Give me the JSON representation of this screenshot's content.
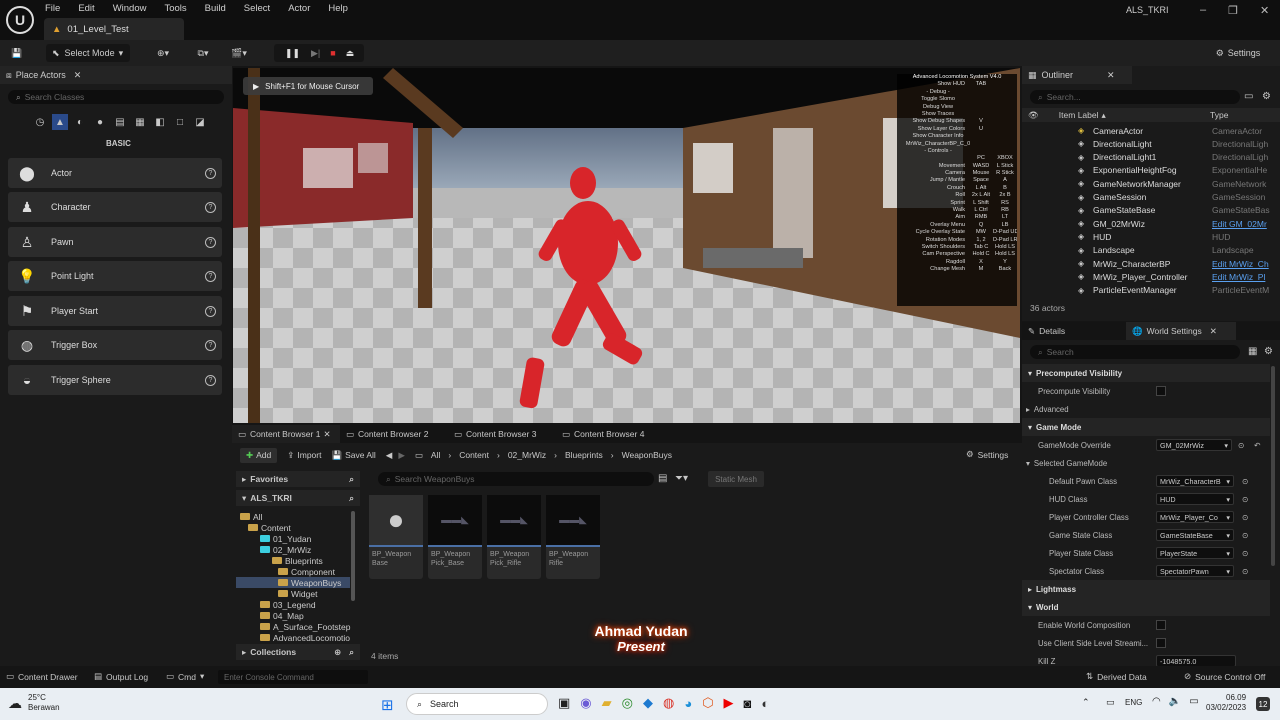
{
  "app": {
    "project": "ALS_TKRI",
    "level_tab": "01_Level_Test",
    "menus": [
      "File",
      "Edit",
      "Window",
      "Tools",
      "Build",
      "Select",
      "Actor",
      "Help"
    ]
  },
  "toolbar": {
    "select_mode": "Select Mode",
    "settings": "Settings"
  },
  "place_actors": {
    "title": "Place Actors",
    "search_placeholder": "Search Classes",
    "category": "BASIC",
    "items": [
      "Actor",
      "Character",
      "Pawn",
      "Point Light",
      "Player Start",
      "Trigger Box",
      "Trigger Sphere"
    ]
  },
  "viewport": {
    "hint": "Shift+F1 for Mouse Cursor",
    "hud_title": "Advanced Locomotion System V4.0",
    "hud_rows": [
      [
        "Show HUD",
        "TAB",
        ""
      ],
      [
        "- Debug -",
        "",
        ""
      ],
      [
        "Toggle Slomo",
        "",
        ""
      ],
      [
        "Debug View",
        "",
        ""
      ],
      [
        "Show Traces",
        "",
        ""
      ],
      [
        "Show Debug Shapes",
        "V",
        ""
      ],
      [
        "Show Layer Colors",
        "U",
        ""
      ],
      [
        "Show Character Info",
        "",
        ""
      ],
      [
        "MrWiz_CharacterBP_C_0",
        "",
        ""
      ],
      [
        "- Controls -",
        "",
        ""
      ],
      [
        "",
        "PC",
        "XBOX"
      ],
      [
        "Movement",
        "WASD",
        "L Stick"
      ],
      [
        "Camera",
        "Mouse",
        "R Stick"
      ],
      [
        "Jump / Mantle",
        "Space",
        "A"
      ],
      [
        "Crouch",
        "L Alt",
        "B"
      ],
      [
        "Roll",
        "2x L Alt",
        "2x B"
      ],
      [
        "Sprint",
        "L Shift",
        "RS"
      ],
      [
        "Walk",
        "L Ctrl",
        "RB"
      ],
      [
        "Aim",
        "RMB",
        "LT"
      ],
      [
        "Overlay Menu",
        "Q",
        "LB"
      ],
      [
        "Cycle Overlay State",
        "MW",
        "D-Pad UD"
      ],
      [
        "Rotation Modes",
        "1, 2",
        "D-Pad LR"
      ],
      [
        "Switch Shoulders",
        "Tab C",
        "Hold LS"
      ],
      [
        "Cam Perspective",
        "Hold C",
        "Hold LS"
      ],
      [
        "Ragdoll",
        "X",
        "Y"
      ],
      [
        "Change Mesh",
        "M",
        "Back"
      ]
    ]
  },
  "content_browser": {
    "tabs": [
      "Content Browser 1",
      "Content Browser 2",
      "Content Browser 3",
      "Content Browser 4"
    ],
    "add": "Add",
    "import": "Import",
    "save_all": "Save All",
    "settings": "Settings",
    "breadcrumb": [
      "All",
      "Content",
      "02_MrWiz",
      "Blueprints",
      "WeaponBuys"
    ],
    "favorites": "Favorites",
    "root": "ALS_TKRI",
    "search_placeholder": "Search WeaponBuys",
    "filter": "Static Mesh",
    "tree": [
      "All",
      "Content",
      "01_Yudan",
      "02_MrWiz",
      "Blueprints",
      "Component",
      "WeaponBuys",
      "Widget",
      "03_Legend",
      "04_Map",
      "A_Surface_Footstep",
      "AdvancedLocomotio"
    ],
    "assets": [
      [
        "BP_Weapon",
        "Base"
      ],
      [
        "BP_Weapon",
        "Pick_Base"
      ],
      [
        "BP_Weapon",
        "Pick_Rifle"
      ],
      [
        "BP_Weapon",
        "Rifle"
      ]
    ],
    "item_count": "4 items",
    "collections": "Collections"
  },
  "outliner": {
    "title": "Outliner",
    "search_placeholder": "Search...",
    "col_label": "Item Label",
    "col_type": "Type",
    "actor_count": "36 actors",
    "rows": [
      [
        "CameraActor",
        "CameraActor"
      ],
      [
        "DirectionalLight",
        "DirectionalLigh"
      ],
      [
        "DirectionalLight1",
        "DirectionalLigh"
      ],
      [
        "ExponentialHeightFog",
        "ExponentialHe"
      ],
      [
        "GameNetworkManager",
        "GameNetwork"
      ],
      [
        "GameSession",
        "GameSession"
      ],
      [
        "GameStateBase",
        "GameStateBas"
      ],
      [
        "GM_02MrWiz",
        "Edit GM_02Mr"
      ],
      [
        "HUD",
        "HUD"
      ],
      [
        "Landscape",
        "Landscape"
      ],
      [
        "MrWiz_CharacterBP",
        "Edit MrWiz_Ch"
      ],
      [
        "MrWiz_Player_Controller",
        "Edit MrWiz_Pl"
      ],
      [
        "ParticleEventManager",
        "ParticleEventM"
      ]
    ]
  },
  "details": {
    "tab_details": "Details",
    "tab_world": "World Settings",
    "search_placeholder": "Search",
    "sections": {
      "precomputed": "Precomputed Visibility",
      "precompute": "Precompute Visibility",
      "advanced": "Advanced",
      "game_mode": "Game Mode",
      "gm_override": "GameMode Override",
      "gm_override_val": "GM_02MrWiz",
      "selected_gm": "Selected GameMode",
      "lightmass": "Lightmass",
      "world": "World",
      "world_comp": "Enable World Composition",
      "client_side": "Use Client Side Level Streami...",
      "kill_z": "Kill Z",
      "kill_z_val": "-1048575.0"
    },
    "gm_rows": [
      [
        "Default Pawn Class",
        "MrWiz_CharacterB"
      ],
      [
        "HUD Class",
        "HUD"
      ],
      [
        "Player Controller Class",
        "MrWiz_Player_Co"
      ],
      [
        "Game State Class",
        "GameStateBase"
      ],
      [
        "Player State Class",
        "PlayerState"
      ],
      [
        "Spectator Class",
        "SpectatorPawn"
      ]
    ]
  },
  "statusbar": {
    "content_drawer": "Content Drawer",
    "output_log": "Output Log",
    "cmd": "Cmd",
    "console_placeholder": "Enter Console Command",
    "derived_data": "Derived Data",
    "source_control": "Source Control Off"
  },
  "watermark": {
    "line1": "Ahmad Yudan",
    "line2": "Present"
  },
  "taskbar": {
    "temp": "25°C",
    "weather": "Berawan",
    "search": "Search",
    "lang": "ENG",
    "time": "06.09",
    "date": "03/02/2023"
  }
}
